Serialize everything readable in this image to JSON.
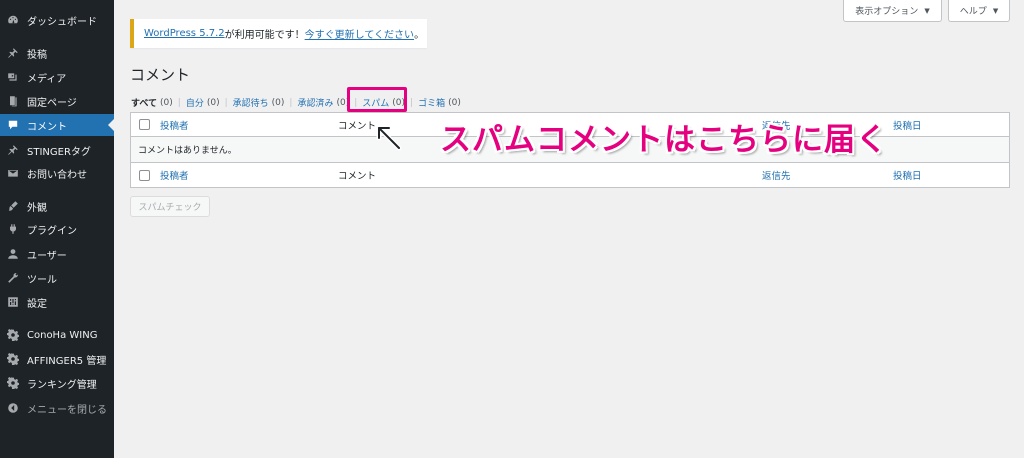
{
  "sidebar": {
    "items": [
      {
        "label": "ダッシュボード",
        "icon": "dashboard-icon"
      },
      {
        "label": "投稿",
        "icon": "pin-icon"
      },
      {
        "label": "メディア",
        "icon": "media-icon"
      },
      {
        "label": "固定ページ",
        "icon": "page-icon"
      },
      {
        "label": "コメント",
        "icon": "comment-icon"
      },
      {
        "label": "STINGERタグ",
        "icon": "pin-icon"
      },
      {
        "label": "お問い合わせ",
        "icon": "mail-icon"
      },
      {
        "label": "外観",
        "icon": "brush-icon"
      },
      {
        "label": "プラグイン",
        "icon": "plugin-icon"
      },
      {
        "label": "ユーザー",
        "icon": "user-icon"
      },
      {
        "label": "ツール",
        "icon": "wrench-icon"
      },
      {
        "label": "設定",
        "icon": "settings-icon"
      },
      {
        "label": "ConoHa WING",
        "icon": "gear-icon"
      },
      {
        "label": "AFFINGER5 管理",
        "icon": "gear-icon"
      },
      {
        "label": "ランキング管理",
        "icon": "gear-icon"
      },
      {
        "label": "メニューを閉じる",
        "icon": "collapse-icon"
      }
    ]
  },
  "screen_meta": {
    "options_label": "表示オプション",
    "help_label": "ヘルプ"
  },
  "notice": {
    "version_link": "WordPress 5.7.2",
    "text_middle": " が利用可能です！",
    "update_link": "今すぐ更新してください",
    "text_end": "。"
  },
  "page_title": "コメント",
  "filters": [
    {
      "label": "すべて",
      "count": "(0)"
    },
    {
      "label": "自分",
      "count": "(0)"
    },
    {
      "label": "承認待ち",
      "count": "(0)"
    },
    {
      "label": "承認済み",
      "count": "(0)"
    },
    {
      "label": "スパム",
      "count": "(0)"
    },
    {
      "label": "ゴミ箱",
      "count": "(0)"
    }
  ],
  "table": {
    "columns": {
      "author": "投稿者",
      "comment": "コメント",
      "in_response_to": "返信先",
      "submitted_on": "投稿日"
    },
    "empty_message": "コメントはありません。"
  },
  "spam_check_button": "スパムチェック",
  "annotation": {
    "text": "スパムコメントはこちらに届く",
    "color": "#e4007f"
  },
  "colors": {
    "sidebar_bg": "#1d2327",
    "accent": "#2271b1",
    "highlight": "#e4007f",
    "notice_border": "#dba617"
  }
}
